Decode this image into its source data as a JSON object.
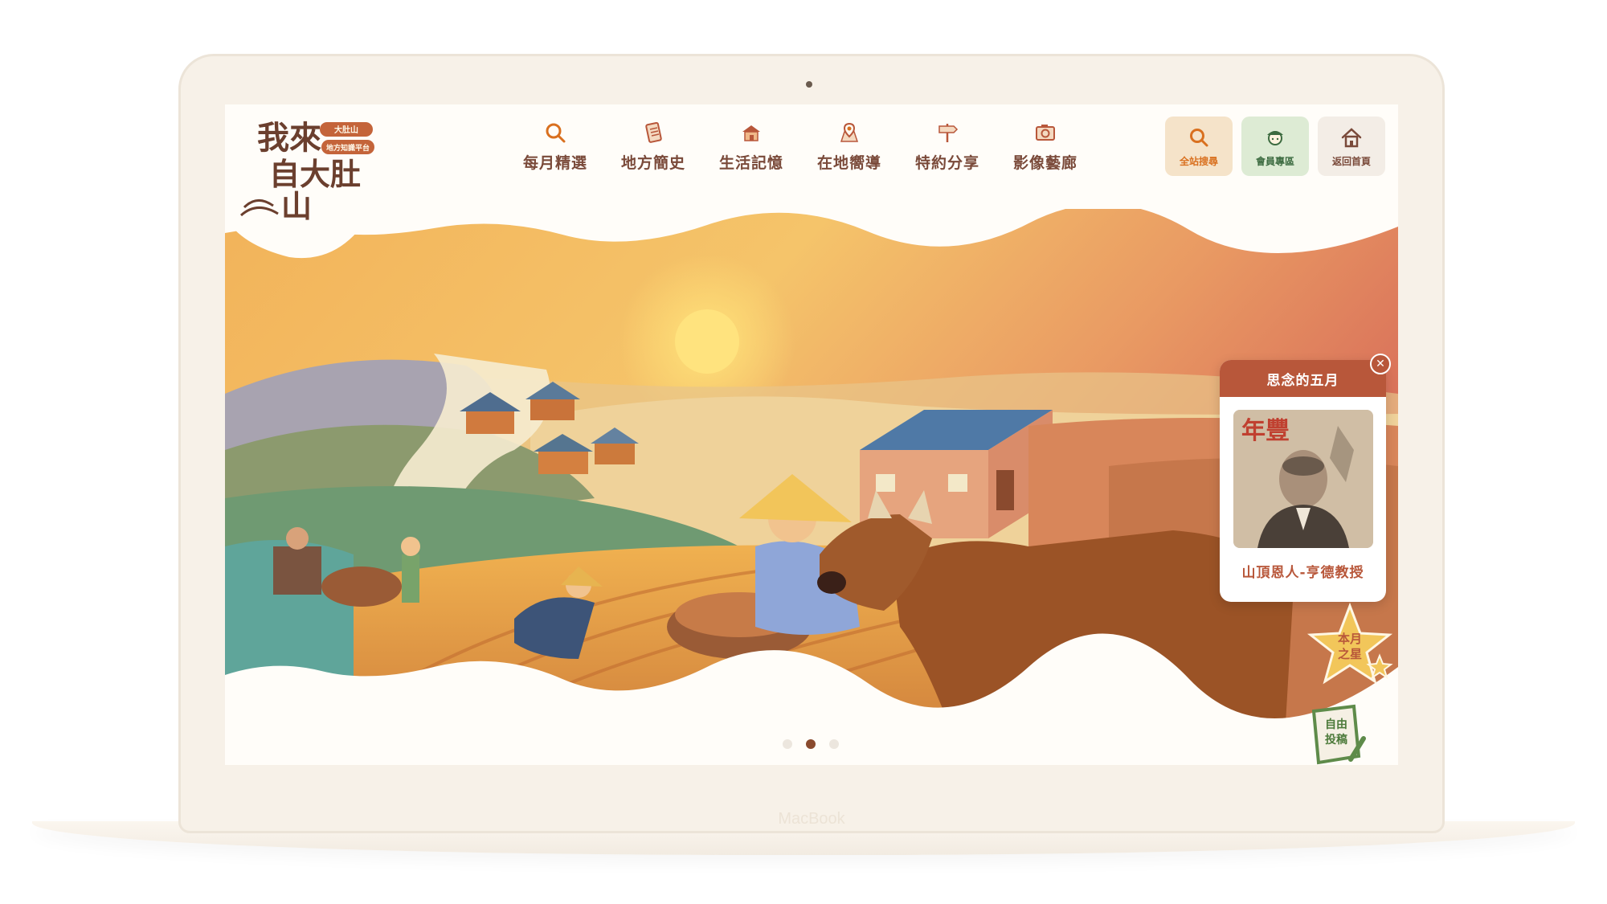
{
  "device": {
    "brand": "MacBook"
  },
  "site": {
    "logo_text": "我來自大肚山",
    "logo_badge_line1": "大肚山",
    "logo_badge_line2": "地方知識平台"
  },
  "nav": [
    {
      "label": "每月精選",
      "icon": "magnifier-icon"
    },
    {
      "label": "地方簡史",
      "icon": "scroll-icon"
    },
    {
      "label": "生活記憶",
      "icon": "house-icon"
    },
    {
      "label": "在地嚮導",
      "icon": "map-pin-icon"
    },
    {
      "label": "特約分享",
      "icon": "signpost-icon"
    },
    {
      "label": "影像藝廊",
      "icon": "camera-icon"
    }
  ],
  "tools": {
    "search": "全站搜尋",
    "member": "會員專區",
    "home": "返回首頁"
  },
  "colors": {
    "brand_brown": "#7a4a3a",
    "accent_rust": "#b8573a",
    "accent_orange": "#d9701f",
    "member_green": "#3c6b40"
  },
  "popup": {
    "title": "思念的五月",
    "image_text": "年豐",
    "caption": "山頂恩人-亨德教授",
    "close_icon": "close-icon"
  },
  "star_badge": {
    "line1": "本月",
    "line2": "之星"
  },
  "submit_badge": {
    "line1": "自由",
    "line2": "投稿"
  },
  "carousel": {
    "slide_count": 3,
    "active_index": 1
  }
}
